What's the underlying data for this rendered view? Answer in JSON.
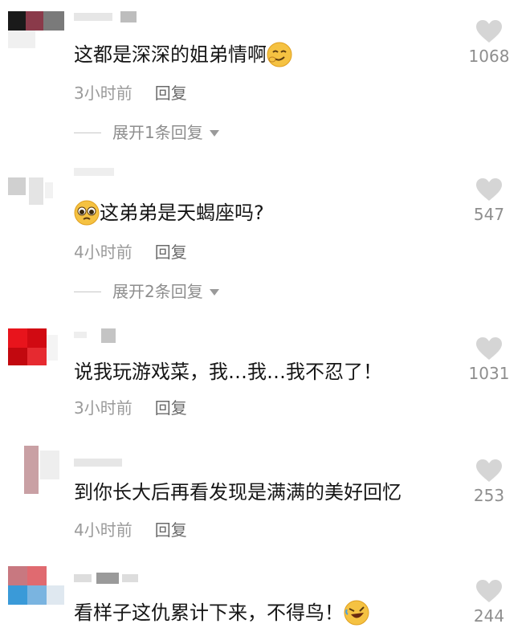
{
  "comments": [
    {
      "text": "这都是深深的姐弟情啊",
      "time": "3小时前",
      "reply": "回复",
      "likes": "1068",
      "expand": "展开1条回复",
      "emoji": "smirk-emoji"
    },
    {
      "text": "这弟弟是天蝎座吗?",
      "time": "4小时前",
      "reply": "回复",
      "likes": "547",
      "expand": "展开2条回复",
      "emoji": "pleading-emoji"
    },
    {
      "text": "说我玩游戏菜，我…我…我不忍了！",
      "time": "3小时前",
      "reply": "回复",
      "likes": "1031"
    },
    {
      "text": "到你长大后再看发现是满满的美好回忆",
      "time": "4小时前",
      "reply": "回复",
      "likes": "253"
    },
    {
      "text": "看样子这仇累计下来，不得鸟！",
      "time": "",
      "reply": "",
      "likes": "244",
      "emoji": "rofl-emoji"
    }
  ],
  "colors": {
    "heart": "#d5d5d5",
    "text": "#161616",
    "meta": "#9a9a9a"
  }
}
